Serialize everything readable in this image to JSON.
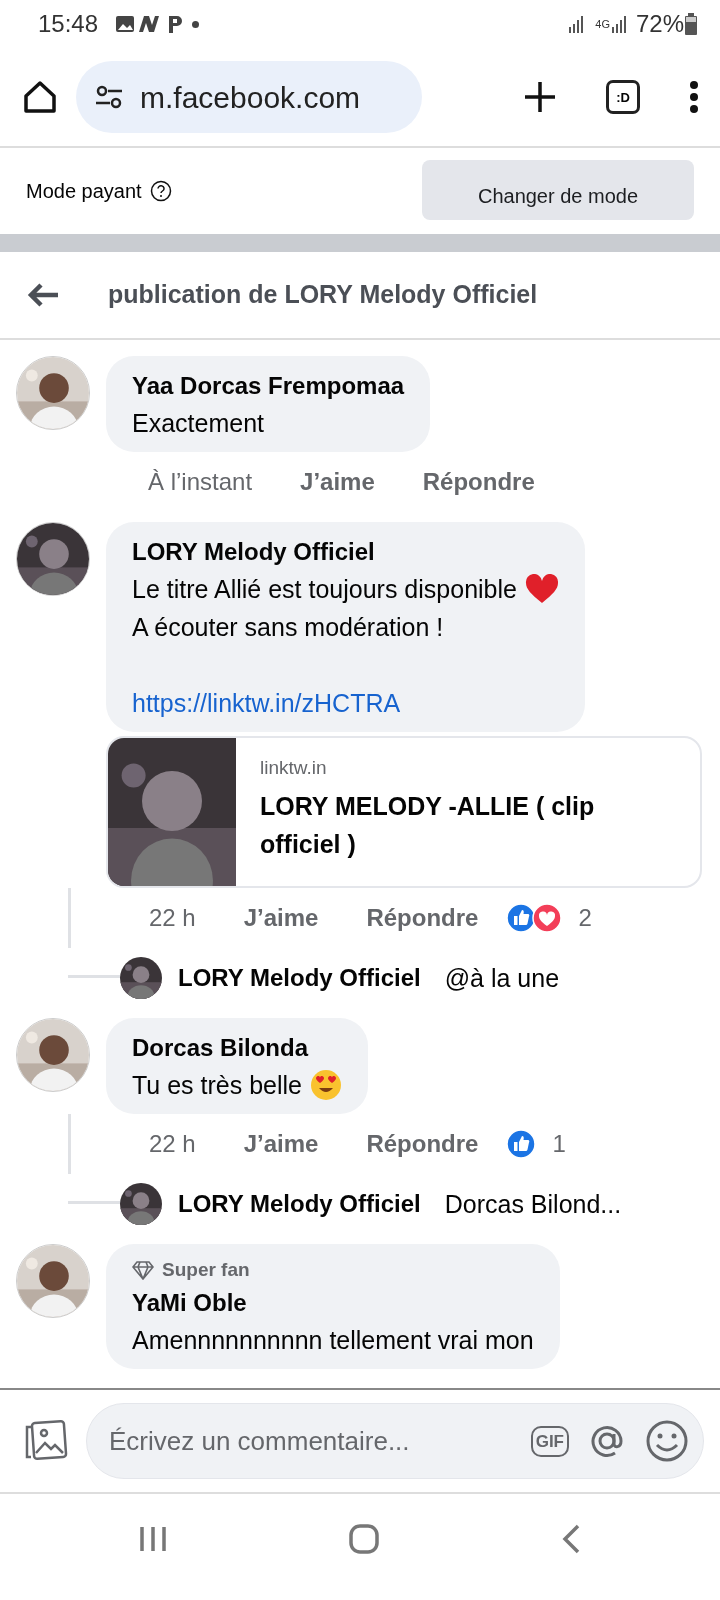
{
  "status_bar": {
    "time": "15:48",
    "network_type": "4G",
    "battery": "72%"
  },
  "browser": {
    "url": "m.facebook.com",
    "tab_label": ":D"
  },
  "mode_bar": {
    "label": "Mode payant",
    "button": "Changer de mode"
  },
  "header": {
    "title": "publication de LORY Melody Officiel"
  },
  "comments": [
    {
      "author": "Yaa Dorcas Frempomaa",
      "lines": [
        {
          "text": "Exactement"
        }
      ],
      "time": "À l’instant",
      "like": "J’aime",
      "reply": "Répondre"
    },
    {
      "author": "LORY Melody Officiel",
      "lines": [
        {
          "text": "Le titre Allié est toujours disponible",
          "emoji": {
            "kind": "heart"
          }
        },
        {
          "text": "A écouter sans modération !"
        },
        {
          "kind": "link",
          "text": "https://linktw.in/zHCTRA"
        }
      ],
      "preview": {
        "domain": "linktw.in",
        "title": "LORY MELODY -ALLIE ( clip officiel )"
      },
      "time": "22 h",
      "like": "J’aime",
      "reply": "Répondre",
      "reactions": [
        {
          "kind": "like"
        },
        {
          "kind": "love"
        }
      ],
      "reaction_count": "2",
      "replies": [
        {
          "author": "LORY Melody Officiel",
          "text": "@à la une"
        }
      ]
    },
    {
      "author": "Dorcas Bilonda",
      "lines": [
        {
          "text": "Tu es très belle",
          "emoji": {
            "kind": "heart-eyes"
          }
        }
      ],
      "time": "22 h",
      "like": "J’aime",
      "reply": "Répondre",
      "reactions": [
        {
          "kind": "like"
        }
      ],
      "reaction_count": "1",
      "replies": [
        {
          "author": "LORY Melody Officiel",
          "text": "Dorcas Bilond..."
        }
      ]
    },
    {
      "author": "YaMi Oble",
      "badge": "Super fan",
      "lines": [
        {
          "text": "Amennnnnnnnnn tellement vrai mon"
        }
      ]
    }
  ],
  "composer": {
    "placeholder": "Écrivez un commentaire...",
    "gif": "GIF"
  }
}
